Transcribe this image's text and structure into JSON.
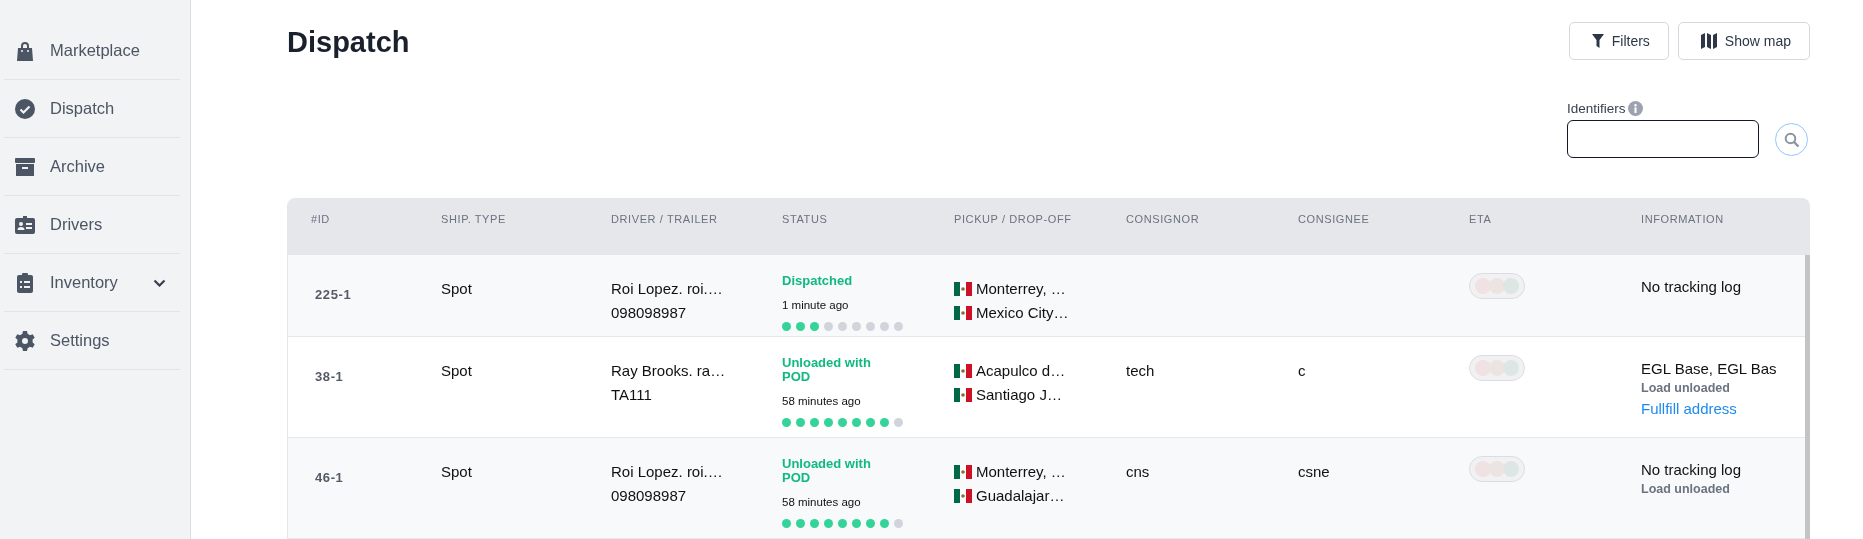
{
  "sidebar": {
    "items": [
      {
        "label": "Marketplace",
        "kind": "bag"
      },
      {
        "label": "Dispatch",
        "kind": "check"
      },
      {
        "label": "Archive",
        "kind": "archive"
      },
      {
        "label": "Drivers",
        "kind": "id"
      },
      {
        "label": "Inventory",
        "kind": "clipboard",
        "expanded": false
      },
      {
        "label": "Settings",
        "kind": "gear"
      }
    ]
  },
  "page": {
    "title": "Dispatch",
    "buttons": [
      {
        "label": "Filters",
        "kind": "filter"
      },
      {
        "label": "Show map",
        "kind": "map"
      }
    ],
    "search": {
      "label": "Identifiers"
    }
  },
  "table": {
    "columns": [
      "#ID",
      "SHIP. TYPE",
      "DRIVER / TRAILER",
      "STATUS",
      "PICKUP / DROP-OFF",
      "CONSIGNOR",
      "CONSIGNEE",
      "ETA",
      "INFORMATION"
    ],
    "rows": [
      {
        "id": "225-1",
        "ship_type": "Spot",
        "driver": "Roi Lopez. roi.…",
        "trailer": "098098987",
        "status": "Dispatched",
        "time": "1 minute ago",
        "level": 0.333,
        "pickup": "Monterrey, …",
        "dropoff": "Mexico City…",
        "consignor": "",
        "consignee": "",
        "info": [
          {
            "kind": "text",
            "text": "No tracking log"
          }
        ]
      },
      {
        "id": "38-1",
        "ship_type": "Spot",
        "driver": "Ray Brooks. ra…",
        "trailer": "TA111",
        "status": "Unloaded with POD",
        "time": "58 minutes ago",
        "level": 0.889,
        "pickup": "Acapulco d…",
        "dropoff": "Santiago J…",
        "consignor": "tech",
        "consignee": "c",
        "info": [
          {
            "kind": "text",
            "text": "EGL Base, EGL Bas"
          },
          {
            "kind": "note",
            "text": "Load unloaded"
          },
          {
            "kind": "link",
            "text": "Fullfill address"
          }
        ]
      },
      {
        "id": "46-1",
        "ship_type": "Spot",
        "driver": "Roi Lopez. roi.…",
        "trailer": "098098987",
        "status": "Unloaded with POD",
        "time": "58 minutes ago",
        "level": 0.889,
        "pickup": "Monterrey, …",
        "dropoff": "Guadalajar…",
        "consignor": "cns",
        "consignee": "csne",
        "info": [
          {
            "kind": "text",
            "text": "No tracking log"
          },
          {
            "kind": "note",
            "text": "Load unloaded"
          }
        ]
      }
    ]
  }
}
